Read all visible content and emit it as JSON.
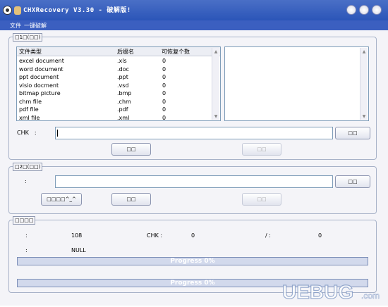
{
  "window": {
    "title": "CHXRecovery V3.30 - 破解版!"
  },
  "menu": {
    "items": [
      "文件",
      "一键破解"
    ]
  },
  "group1": {
    "caption": "□1□(□□)"
  },
  "group2": {
    "caption": "□2□(□□)"
  },
  "group3": {
    "caption": "□□□□"
  },
  "filetable": {
    "columns": [
      "文件类型",
      "后缀名",
      "可恢复个数"
    ],
    "rows": [
      {
        "type": "excel document",
        "ext": ".xls",
        "count": "0"
      },
      {
        "type": "word document",
        "ext": ".doc",
        "count": "0"
      },
      {
        "type": "ppt document",
        "ext": ".ppt",
        "count": "0"
      },
      {
        "type": "visio docment",
        "ext": ".vsd",
        "count": "0"
      },
      {
        "type": "bitmap picture",
        "ext": ".bmp",
        "count": "0"
      },
      {
        "type": "chm file",
        "ext": ".chm",
        "count": "0"
      },
      {
        "type": "pdf file",
        "ext": ".pdf",
        "count": "0"
      },
      {
        "type": "xml file",
        "ext": ".xml",
        "count": "0"
      }
    ]
  },
  "chk": {
    "label": "CHK　:",
    "value": ""
  },
  "buttons": {
    "browse1": "□□",
    "start": "□□",
    "stop": "□□",
    "browse2": "□□",
    "special": "□□□□^_^",
    "mid": "□□",
    "right": "□□"
  },
  "path2": {
    "label": ":",
    "value": ""
  },
  "status": {
    "label1": ":",
    "value1": "108",
    "chk_label": "CHK :",
    "chk_value": "0",
    "slash": "/ :",
    "slash_value": "0",
    "label2": ":",
    "value2": "NULL"
  },
  "progress": [
    {
      "text": "Progress 0%",
      "fraction": 0
    },
    {
      "text": "Progress 0%",
      "fraction": 0
    }
  ],
  "watermark": {
    "text": "UEBUG",
    "suffix": ".com"
  },
  "colors": {
    "title": "#2b55b8",
    "progress": "#4a6fc6"
  }
}
